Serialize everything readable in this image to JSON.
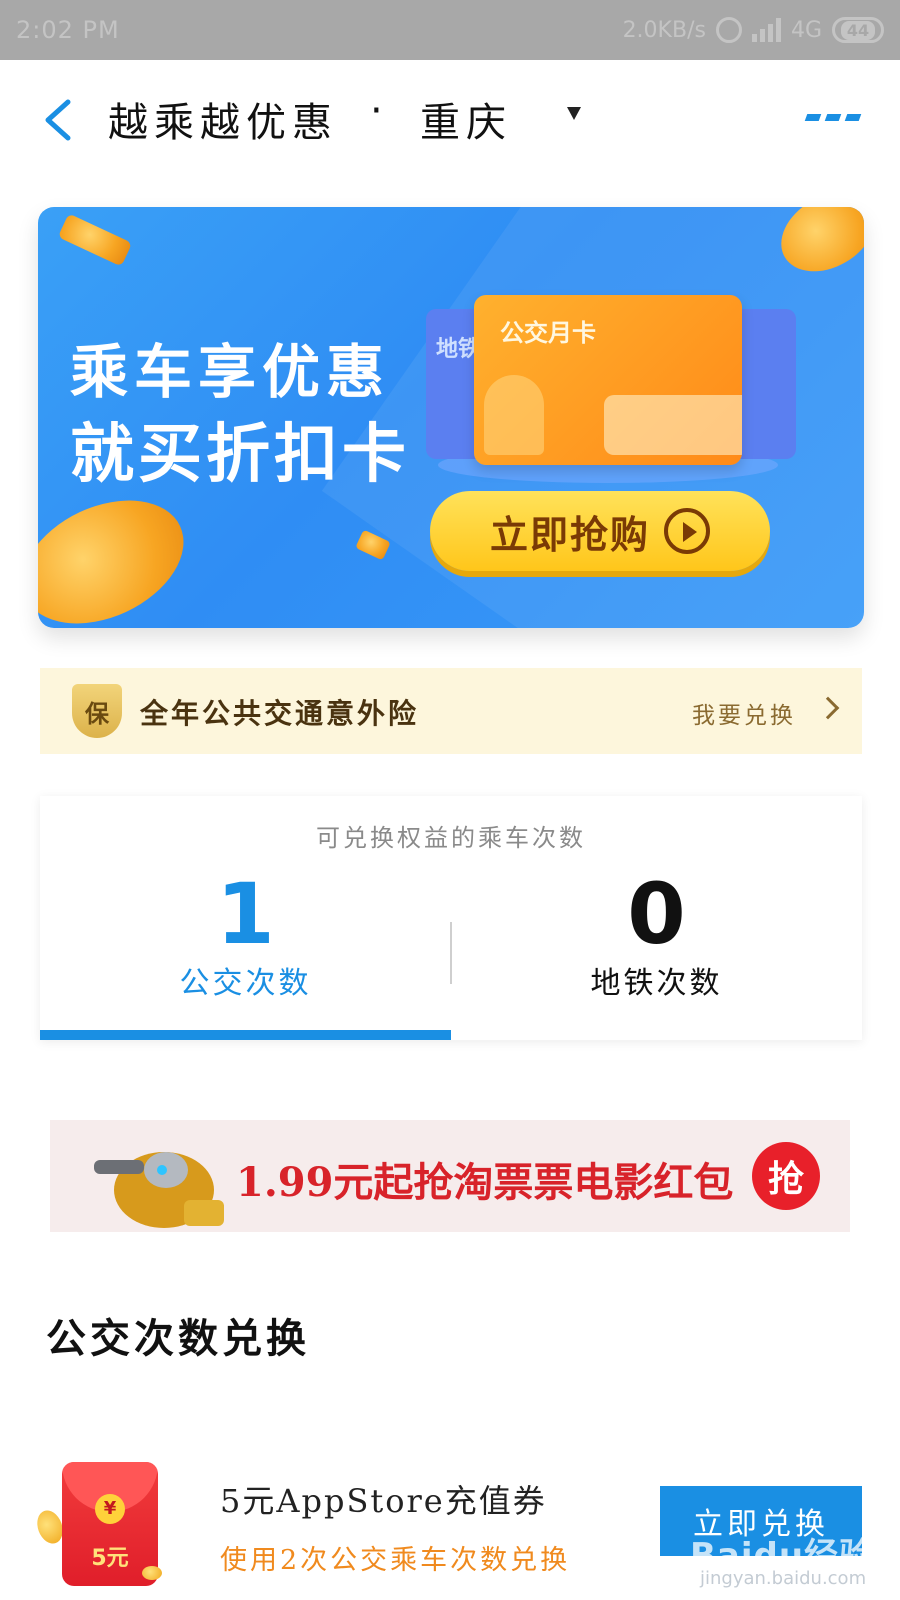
{
  "status_bar": {
    "time": "2:02 PM",
    "network_speed": "2.0KB/s",
    "network_type": "4G",
    "battery": "44"
  },
  "header": {
    "title": "越乘越优惠",
    "separator": "·",
    "city": "重庆"
  },
  "banner": {
    "line1": "乘车享优惠",
    "line2": "就买折扣卡",
    "card_back_label": "地铁",
    "card_front_label": "公交月卡",
    "button_label": "立即抢购"
  },
  "insurance": {
    "badge": "保",
    "title": "全年公共交通意外险",
    "action": "我要兑换"
  },
  "counts": {
    "caption": "可兑换权益的乘车次数",
    "bus": {
      "value": "1",
      "label": "公交次数"
    },
    "metro": {
      "value": "0",
      "label": "地铁次数"
    }
  },
  "movie_ad": {
    "text": "1.99元起抢淘票票电影红包",
    "button": "抢"
  },
  "section": {
    "title": "公交次数兑换"
  },
  "voucher": {
    "icon_symbol": "¥",
    "icon_amount": "5元",
    "title": "5元AppStore充值券",
    "subtitle": "使用2次公交乘车次数兑换",
    "button": "立即兑换"
  },
  "watermark": {
    "logo": "Baidu经验",
    "url": "jingyan.baidu.com"
  }
}
